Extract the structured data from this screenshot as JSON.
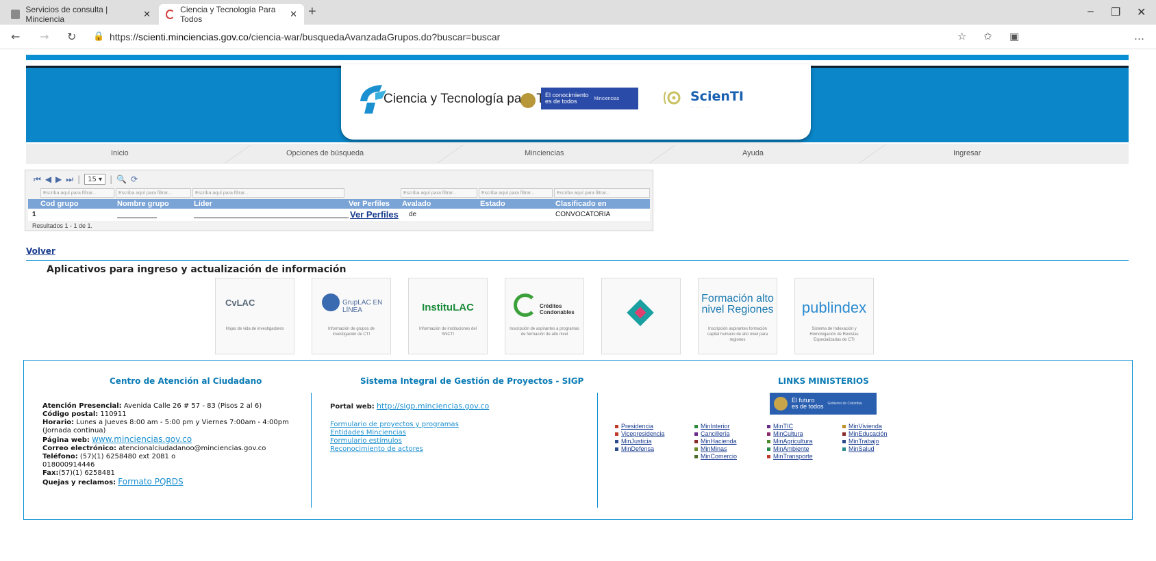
{
  "browser": {
    "tabs": [
      {
        "label": "Servicios de consulta | Minciencia",
        "active": false
      },
      {
        "label": "Ciencia y Tecnología Para Todos",
        "active": true
      }
    ],
    "url_prefix": "https://",
    "url_domain": "scienti.minciencias.gov.co",
    "url_path": "/ciencia-war/busquedaAvanzadaGrupos.do?buscar=buscar"
  },
  "header": {
    "brand_text": "Ciencia y Tecnología para Todos",
    "conocimiento_line1": "El conocimiento",
    "conocimiento_line2": "es de todos",
    "minciencias_small": "Minciencias",
    "scienti_title": "ScienTI",
    "accent": "#0a86c9"
  },
  "menu": [
    "Inicio",
    "Opciones de búsqueda",
    "Minciencias",
    "Ayuda",
    "Ingresar"
  ],
  "grid": {
    "page_size": "15",
    "filter_placeholder": "Escriba aquí para filtrar...",
    "columns": [
      "Cod grupo",
      "Nombre grupo",
      "Líder",
      "Ver Perfiles",
      "Avalado",
      "Estado",
      "Clasificado en"
    ],
    "rows": [
      {
        "cod": "1",
        "nombre": "",
        "lider": "",
        "ver": "Ver Perfiles",
        "avalado": "de",
        "estado": "",
        "clasificado": "CONVOCATORIA"
      }
    ],
    "results": "Resultados 1 - 1 de 1."
  },
  "volver": "Volver",
  "apps_title": "Aplicativos para ingreso y actualización de información",
  "apps": [
    {
      "name": "CvLAC",
      "desc": "Hojas de vida de investigadores",
      "color": "#6a7a8a"
    },
    {
      "name": "GrupLAC EN LÍNEA",
      "desc": "Información de grupos de investigación de CTI",
      "color": "#3a6ab0"
    },
    {
      "name": "InstituLAC",
      "desc": "Información de instituciones del SNCTI",
      "color": "#1a8a3a"
    },
    {
      "name": "Créditos Condonables",
      "desc": "Inscripción de aspirantes a programas de formación de alto nivel",
      "color": "#3aa03a"
    },
    {
      "name": "",
      "desc": "",
      "color": "#1aa0a0"
    },
    {
      "name": "Formación alto nivel Regiones",
      "desc": "Inscripción aspirantes formación capital humano de alto nivel para regiones",
      "color": "#1a7ab0"
    },
    {
      "name": "publindex",
      "desc": "Sistema de Indexación y Homologación de Revistas Especializadas de CTI",
      "color": "#2a8ad0"
    }
  ],
  "footer": {
    "centro_title": "Centro de Atención al Ciudadano",
    "sigp_title": "Sistema Integral de Gestión de Proyectos - SIGP",
    "links_title": "LINKS MINISTERIOS",
    "info": {
      "presencial_label": "Atención Presencial:",
      "presencial_value": " Avenida Calle 26 # 57 - 83 (Pisos 2 al 6)",
      "postal_label": "Código postal:",
      "postal_value": " 110911",
      "horario_label": "Horario:",
      "horario_value": " Lunes a Jueves 8:00 am - 5:00 pm y Viernes 7:00am - 4:00pm (Jornada continua)",
      "web_label": "Página web:",
      "web_value": "www.minciencias.gov.co",
      "correo_label": "Correo electrónico:",
      "correo_value": " atencionalciudadanoo@minciencias.gov.co",
      "telefono_label": "Teléfono:",
      "telefono_value": " (57)(1) 6258480 ext 2081 o 018000914446",
      "fax_label": "Fax:",
      "fax_value": "(57)(1) 6258481",
      "quejas_label": "Quejas y reclamos:",
      "quejas_value": "Formato PQRDS"
    },
    "sigp": {
      "portal_label": "Portal web:",
      "portal_value": "http://sigp.minciencias.gov.co",
      "links": [
        "Formulario de proyectos y programas",
        "Entidades Minciencias",
        "Formulario estímulos",
        "Reconocimiento de actores"
      ]
    },
    "min_banner_line1": "El futuro",
    "min_banner_line2": "es de todos",
    "min_banner_small": "Gobierno de Colombia",
    "ministerios": [
      [
        {
          "t": "Presidencia",
          "c": "#c0392b"
        },
        {
          "t": "Vicepresidencia",
          "c": "#c0392b"
        },
        {
          "t": "MinJusticia",
          "c": "#2a4a8a"
        },
        {
          "t": "MinDefensa",
          "c": "#2a4a8a"
        }
      ],
      [
        {
          "t": "MinInterior",
          "c": "#2a8a3a"
        },
        {
          "t": "Cancillería",
          "c": "#6a2a8a"
        },
        {
          "t": "MinHacienda",
          "c": "#8a2a2a"
        },
        {
          "t": "MinMinas",
          "c": "#6a8a2a"
        },
        {
          "t": "MinComercio",
          "c": "#4a6a2a"
        }
      ],
      [
        {
          "t": "MinTIC",
          "c": "#6a2a8a"
        },
        {
          "t": "MinCultura",
          "c": "#8a2a6a"
        },
        {
          "t": "MinAgricultura",
          "c": "#4a8a2a"
        },
        {
          "t": "MinAmbiente",
          "c": "#2a8a4a"
        },
        {
          "t": "MinTransporte",
          "c": "#c0392b"
        }
      ],
      [
        {
          "t": "MinVivienda",
          "c": "#c0902b"
        },
        {
          "t": "MinEducación",
          "c": "#8a2a2a"
        },
        {
          "t": "MinTrabajo",
          "c": "#2a4a8a"
        },
        {
          "t": "MinSalud",
          "c": "#2a8a8a"
        }
      ]
    ]
  }
}
